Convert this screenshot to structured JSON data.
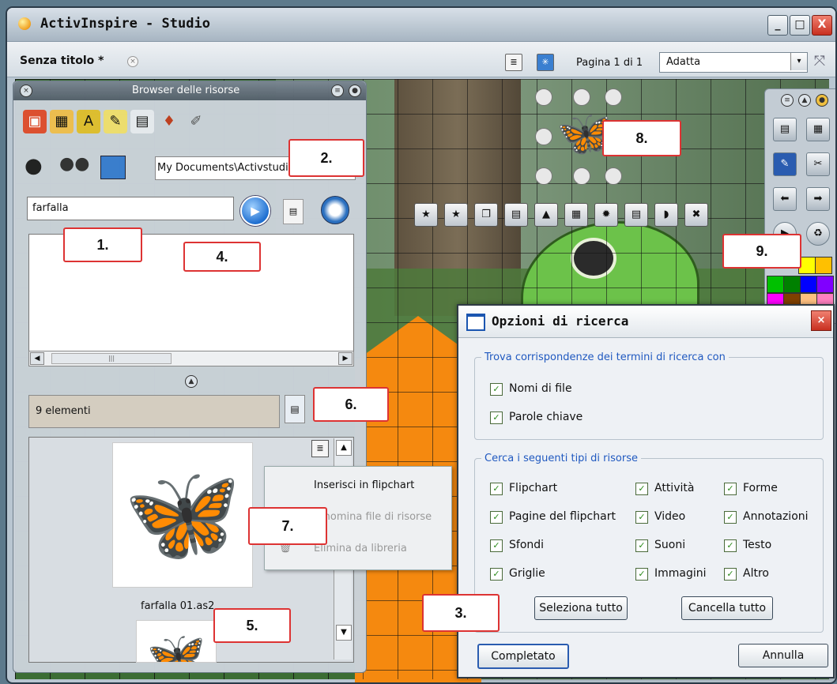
{
  "window": {
    "title": "ActivInspire - Studio",
    "min_label": "_",
    "max_label": "□",
    "close_label": "X"
  },
  "tabbar": {
    "tab_title": "Senza titolo *",
    "tab_close": "×",
    "page_info": "Pagina 1 di 1",
    "zoom_value": "Adatta",
    "zoom_arrow": "▾"
  },
  "browser": {
    "title": "Browser delle risorse",
    "path": "My Documents\\Activstudio",
    "search_value": "farfalla",
    "count_label": "9 elementi",
    "file_name": "farfalla 01.as2",
    "context_menu": [
      "Inserisci in flipchart",
      "Rinomina file di risorse",
      "Elimina da libreria"
    ]
  },
  "dialog": {
    "title": "Opzioni di ricerca",
    "group1": "Trova corrispondenze dei termini di ricerca con",
    "match_options": [
      "Nomi di file",
      "Parole chiave"
    ],
    "group2": "Cerca i seguenti tipi di risorse",
    "types_col1": [
      "Flipchart",
      "Pagine del flipchart",
      "Sfondi",
      "Griglie"
    ],
    "types_col2": [
      "Attività",
      "Video",
      "Suoni",
      "Immagini"
    ],
    "types_col3": [
      "Forme",
      "Annotazioni",
      "Testo",
      "Altro"
    ],
    "select_all": "Seleziona tutto",
    "clear_all": "Cancella tutto",
    "done": "Completato",
    "cancel": "Annulla",
    "check_mark": "✓"
  },
  "callouts": [
    "1.",
    "2.",
    "3.",
    "4.",
    "5.",
    "6.",
    "7.",
    "8.",
    "9."
  ],
  "palette_colors": [
    "#ffff00",
    "#ffc000",
    "#00c000",
    "#008000",
    "#0000ff",
    "#8000ff",
    "#ff00ff",
    "#804000",
    "#ffc080",
    "#ff80c0",
    "#c00000"
  ]
}
